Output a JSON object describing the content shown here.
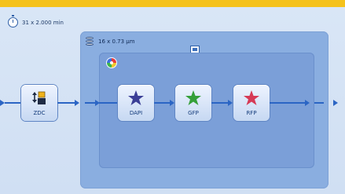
{
  "timelapse": {
    "label": "31 x 2.000 min",
    "icon": "stopwatch-icon"
  },
  "xy_block": {
    "label": "16 x 0.73 µm",
    "icon": "stack-icon",
    "view_icon": "image-icon"
  },
  "channel_block": {
    "icon": "palette-icon"
  },
  "nodes": [
    {
      "label": "ZDC",
      "icon": "zdc-icon"
    },
    {
      "label": "DAPI",
      "icon": "star-icon",
      "color": "#3b3f97"
    },
    {
      "label": "GFP",
      "icon": "star-icon",
      "color": "#35a03a"
    },
    {
      "label": "RFP",
      "icon": "star-icon",
      "color": "#d63a56"
    }
  ],
  "colors": {
    "accent": "#f5c21b",
    "flow": "#2b65c4",
    "outer": "#8aaee0",
    "inner": "#7b9fd8"
  }
}
